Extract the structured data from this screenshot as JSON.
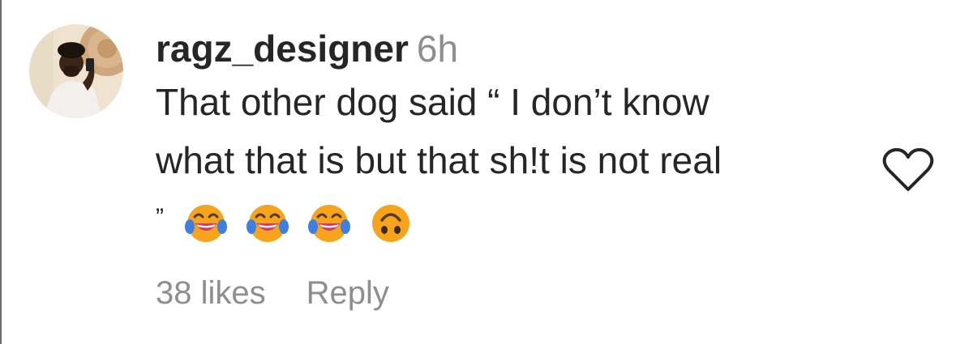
{
  "comment": {
    "username": "ragz_designer",
    "time": "6h",
    "text_lines": [
      "That other dog said “ I don’t know",
      "what that is but that sh!t is not real"
    ],
    "closing_quote": "”",
    "emojis": [
      "face-with-tears-of-joy-icon",
      "face-with-tears-of-joy-icon",
      "face-with-tears-of-joy-icon",
      "upside-down-face-icon"
    ],
    "likes": "38 likes",
    "reply_label": "Reply"
  },
  "colors": {
    "text": "#262626",
    "secondary": "#8e8e8e",
    "emoji_face": "#f7a41d"
  }
}
